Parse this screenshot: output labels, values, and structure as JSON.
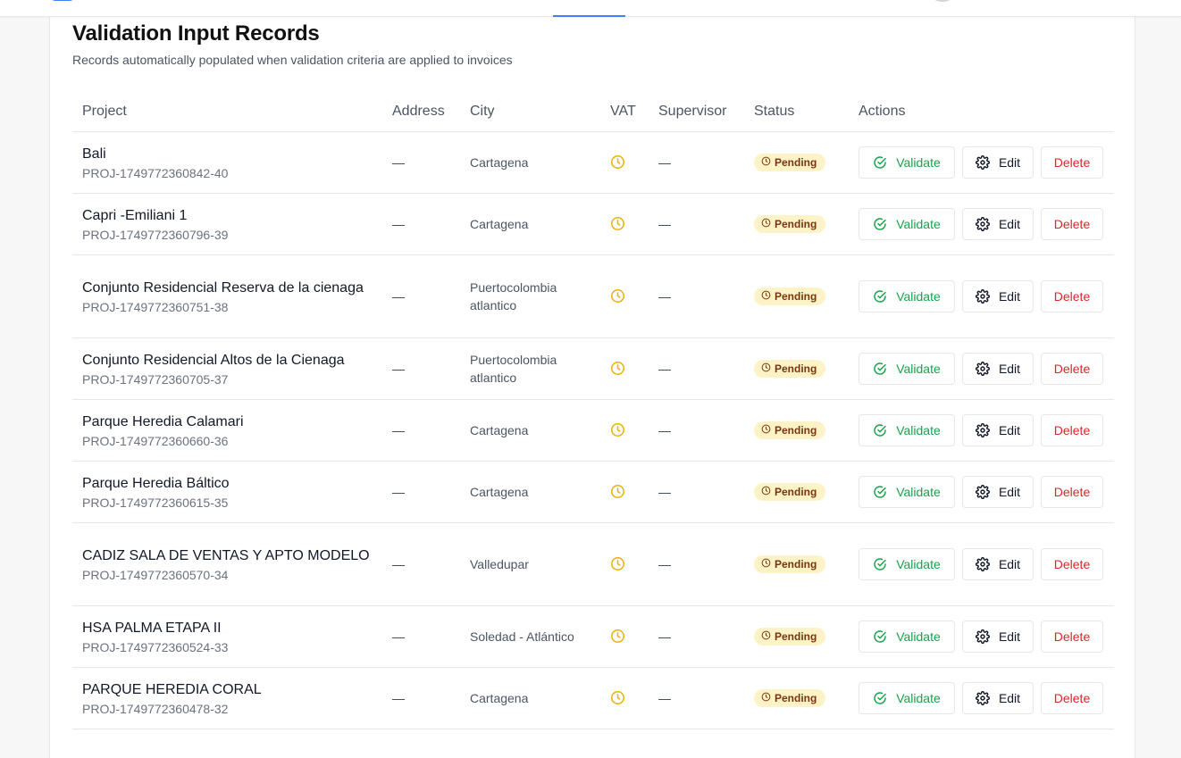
{
  "header": {
    "title": "Validation Input Records",
    "subtitle": "Records automatically populated when validation criteria are applied to invoices"
  },
  "table": {
    "columns": [
      "Project",
      "Address",
      "City",
      "VAT",
      "Supervisor",
      "Status",
      "Actions"
    ],
    "actions": {
      "validate": "Validate",
      "edit": "Edit",
      "delete": "Delete"
    },
    "rows": [
      {
        "name": "Bali",
        "code": "PROJ-1749772360842-40",
        "address": "—",
        "city": "Cartagena",
        "supervisor": "—",
        "status": "Pending",
        "tall": false
      },
      {
        "name": "Capri -Emiliani 1",
        "code": "PROJ-1749772360796-39",
        "address": "—",
        "city": "Cartagena",
        "supervisor": "—",
        "status": "Pending",
        "tall": false
      },
      {
        "name": "Conjunto Residencial Reserva de la cienaga",
        "code": "PROJ-1749772360751-38",
        "address": "—",
        "city": "Puertocolombia atlantico",
        "supervisor": "—",
        "status": "Pending",
        "tall": true
      },
      {
        "name": "Conjunto Residencial Altos de la Cienaga",
        "code": "PROJ-1749772360705-37",
        "address": "—",
        "city": "Puertocolombia atlantico",
        "supervisor": "—",
        "status": "Pending",
        "tall": false
      },
      {
        "name": "Parque Heredia Calamari",
        "code": "PROJ-1749772360660-36",
        "address": "—",
        "city": "Cartagena",
        "supervisor": "—",
        "status": "Pending",
        "tall": false
      },
      {
        "name": "Parque Heredia Báltico",
        "code": "PROJ-1749772360615-35",
        "address": "—",
        "city": "Cartagena",
        "supervisor": "—",
        "status": "Pending",
        "tall": false
      },
      {
        "name": "CADIZ SALA DE VENTAS Y APTO MODELO",
        "code": "PROJ-1749772360570-34",
        "address": "—",
        "city": "Valledupar",
        "supervisor": "—",
        "status": "Pending",
        "tall": true
      },
      {
        "name": "HSA PALMA ETAPA II",
        "code": "PROJ-1749772360524-33",
        "address": "—",
        "city": "Soledad - Atlántico",
        "supervisor": "—",
        "status": "Pending",
        "tall": false
      },
      {
        "name": "PARQUE HEREDIA CORAL",
        "code": "PROJ-1749772360478-32",
        "address": "—",
        "city": "Cartagena",
        "supervisor": "—",
        "status": "Pending",
        "tall": false
      }
    ]
  },
  "colors": {
    "pending_bg": "#fef3c7",
    "pending_text": "#78350f",
    "vat_clock": "#eab308",
    "validate": "#16a34a",
    "delete": "#dc2626",
    "accent": "#3b82f6"
  },
  "icons": {
    "vat": "clock-icon",
    "status": "clock-icon",
    "validate": "check-circle-icon",
    "edit": "gear-icon"
  }
}
